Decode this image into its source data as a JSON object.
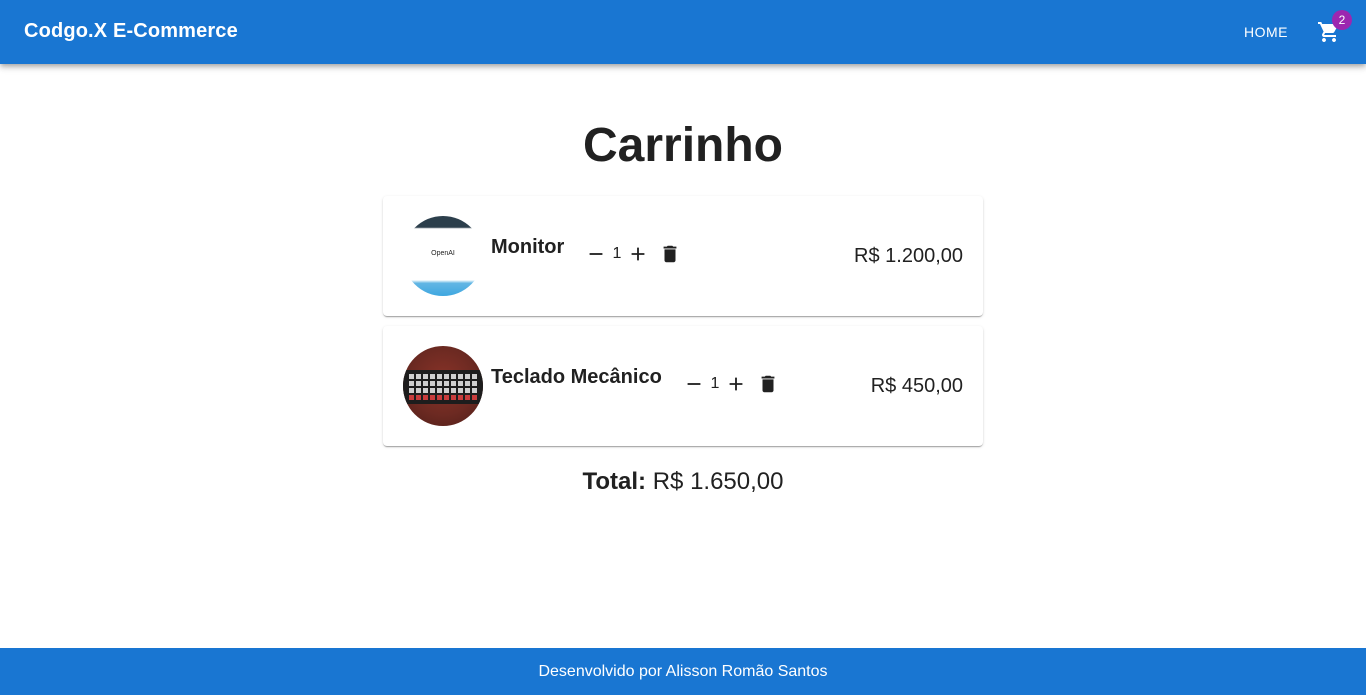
{
  "header": {
    "brand": "Codgo.X E-Commerce",
    "home_label": "HOME",
    "cart_count": "2",
    "cart_icon": "shopping-cart-icon"
  },
  "page": {
    "title": "Carrinho"
  },
  "cart": {
    "items": [
      {
        "name": "Monitor",
        "quantity": "1",
        "price": "R$ 1.200,00",
        "image_text": "OpenAI"
      },
      {
        "name": "Teclado Mecânico",
        "quantity": "1",
        "price": "R$ 450,00"
      }
    ],
    "total_label": "Total:",
    "total_value": "R$ 1.650,00"
  },
  "icons": {
    "decrease": "minus-icon",
    "increase": "plus-icon",
    "remove": "trash-icon"
  },
  "colors": {
    "primary": "#1976d2",
    "badge": "#9c27b0",
    "text": "#212121"
  },
  "footer": {
    "text": "Desenvolvido por Alisson Romão Santos"
  }
}
